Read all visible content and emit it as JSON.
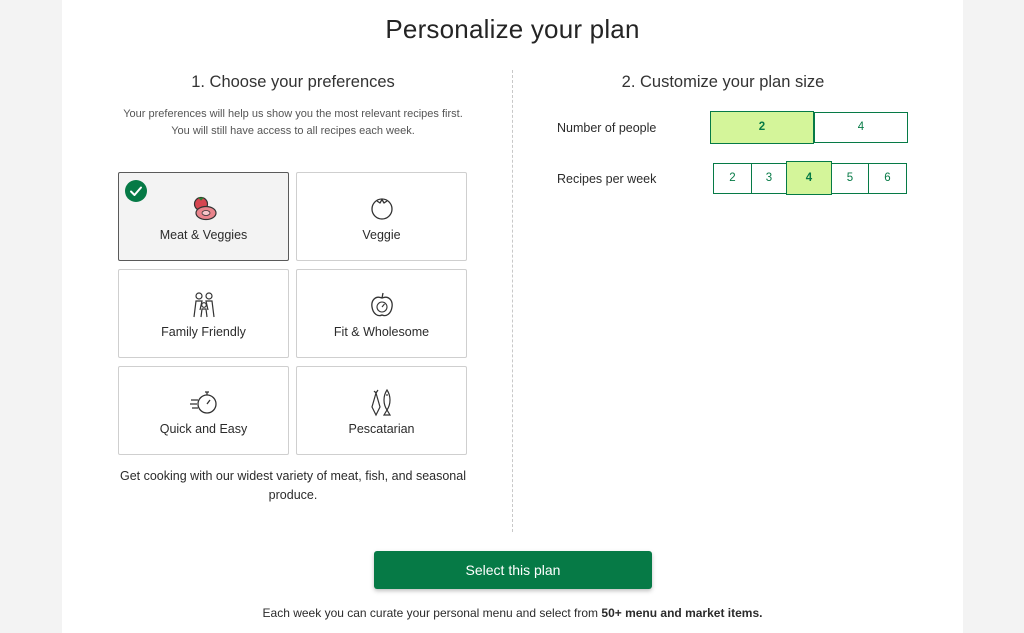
{
  "page": {
    "title": "Personalize your plan"
  },
  "preferences": {
    "heading": "1. Choose your preferences",
    "description": "Your preferences will help us show you the most relevant recipes first. You will still have access to all recipes each week.",
    "items": [
      {
        "label": "Meat & Veggies",
        "icon": "meat-veggies-icon",
        "selected": true
      },
      {
        "label": "Veggie",
        "icon": "tomato-icon",
        "selected": false
      },
      {
        "label": "Family Friendly",
        "icon": "family-icon",
        "selected": false
      },
      {
        "label": "Fit & Wholesome",
        "icon": "apple-scale-icon",
        "selected": false
      },
      {
        "label": "Quick and Easy",
        "icon": "stopwatch-icon",
        "selected": false
      },
      {
        "label": "Pescatarian",
        "icon": "fish-carrot-icon",
        "selected": false
      }
    ],
    "selected_note": "Get cooking with our widest variety of meat, fish, and seasonal produce."
  },
  "plan_size": {
    "heading": "2. Customize your plan size",
    "people": {
      "label": "Number of people",
      "options": [
        "2",
        "4"
      ],
      "selected": "2"
    },
    "recipes": {
      "label": "Recipes per week",
      "options": [
        "2",
        "3",
        "4",
        "5",
        "6"
      ],
      "selected": "4"
    }
  },
  "cta": {
    "label": "Select this plan"
  },
  "footer": {
    "text_before": "Each week you can curate your personal menu and select from ",
    "text_bold": "50+ menu and market items."
  },
  "colors": {
    "brand_green": "#067a46",
    "selected_fill": "#d4f59a",
    "icon_red": "#d64550"
  }
}
